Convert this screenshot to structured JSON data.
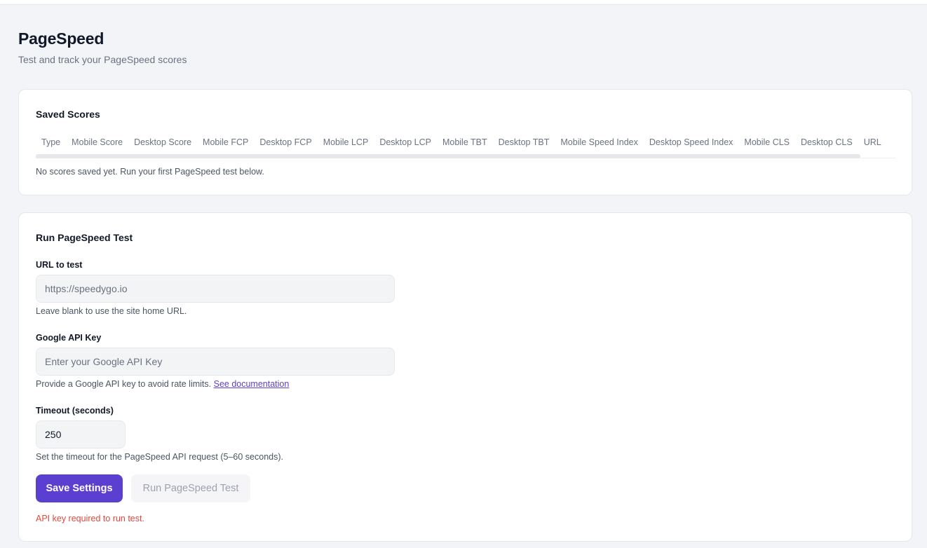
{
  "header": {
    "title": "PageSpeed",
    "subtitle": "Test and track your PageSpeed scores"
  },
  "saved_scores": {
    "title": "Saved Scores",
    "columns": [
      "Type",
      "Mobile Score",
      "Desktop Score",
      "Mobile FCP",
      "Desktop FCP",
      "Mobile LCP",
      "Desktop LCP",
      "Mobile TBT",
      "Desktop TBT",
      "Mobile Speed Index",
      "Desktop Speed Index",
      "Mobile CLS",
      "Desktop CLS",
      "URL"
    ],
    "empty_message": "No scores saved yet. Run your first PageSpeed test below."
  },
  "run_test": {
    "title": "Run PageSpeed Test",
    "url_field": {
      "label": "URL to test",
      "value": "",
      "placeholder": "https://speedygo.io",
      "help": "Leave blank to use the site home URL."
    },
    "api_key_field": {
      "label": "Google API Key",
      "value": "",
      "placeholder": "Enter your Google API Key",
      "help": "Provide a Google API key to avoid rate limits.",
      "help_link": "See documentation"
    },
    "timeout_field": {
      "label": "Timeout (seconds)",
      "value": "250",
      "help": "Set the timeout for the PageSpeed API request (5–60 seconds)."
    },
    "save_label": "Save Settings",
    "run_label": "Run PageSpeed Test",
    "error": "API key required to run test."
  },
  "colors": {
    "accent": "#5b3fd1",
    "error": "#e0483c",
    "background": "#f3f4f7"
  }
}
